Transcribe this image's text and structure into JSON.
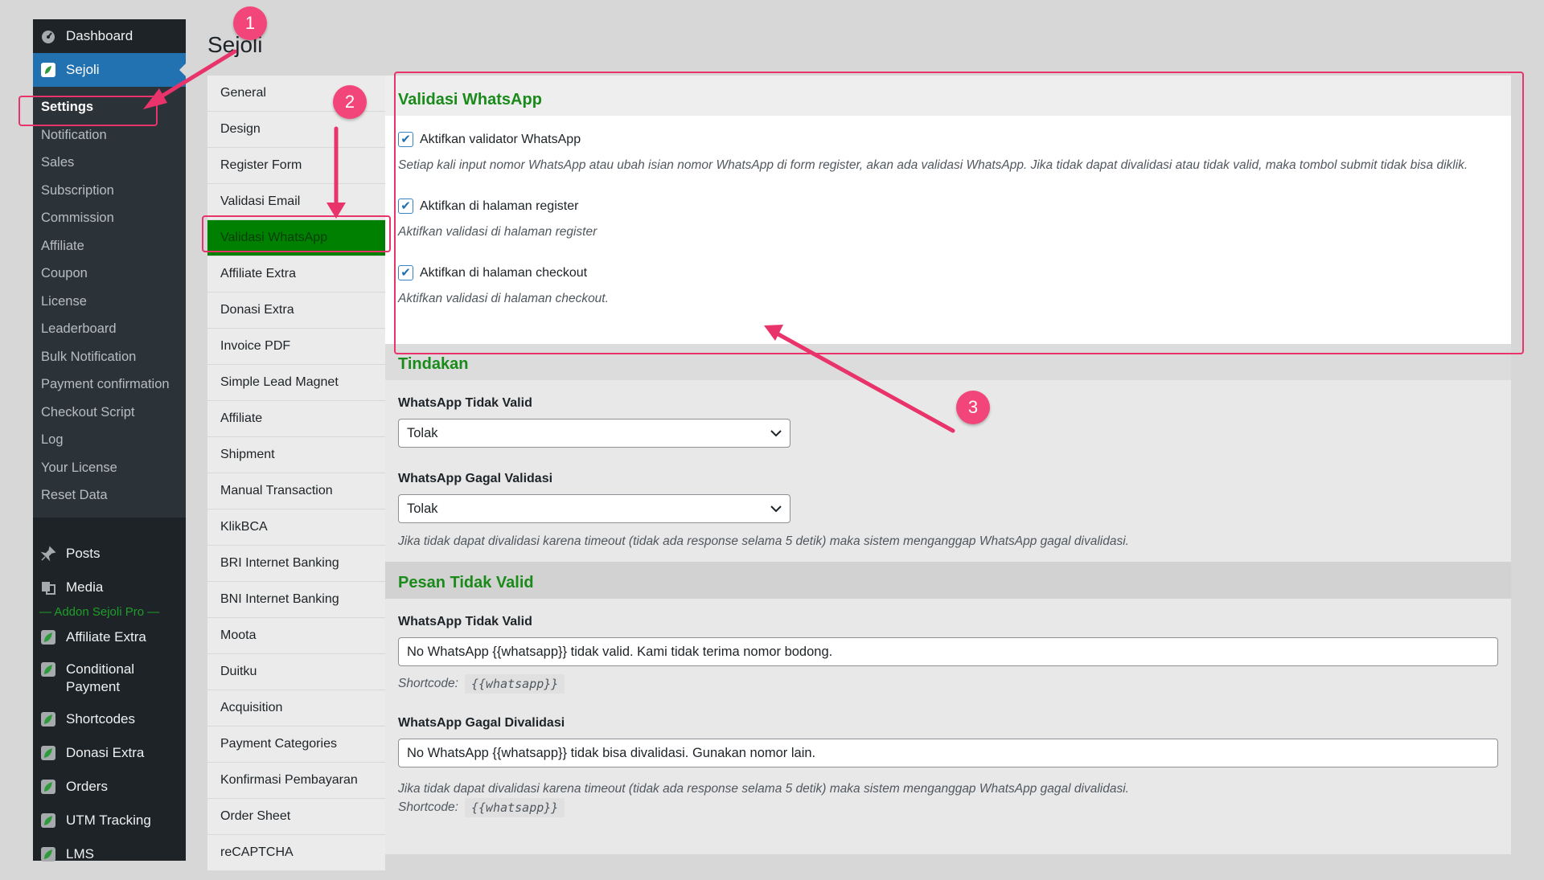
{
  "page": {
    "title": "Sejoli"
  },
  "sidebar": {
    "top_items": [
      {
        "label": "Dashboard",
        "icon": "dashboard-icon"
      },
      {
        "label": "Sejoli",
        "icon": "sejoli-icon"
      }
    ],
    "sejoli_submenu": [
      "Settings",
      "Notification",
      "Sales",
      "Subscription",
      "Commission",
      "Affiliate",
      "Coupon",
      "License",
      "Leaderboard",
      "Bulk Notification",
      "Payment confirmation",
      "Checkout Script",
      "Log",
      "Your License",
      "Reset Data"
    ],
    "items_after": [
      {
        "label": "Posts",
        "icon": "pin-icon"
      },
      {
        "label": "Media",
        "icon": "media-icon"
      }
    ],
    "addon_separator": "— Addon Sejoli Pro —",
    "addon_items": [
      "Affiliate Extra",
      "Conditional Payment",
      "Shortcodes",
      "Donasi Extra",
      "Orders",
      "UTM Tracking",
      "LMS"
    ]
  },
  "tabs": [
    "General",
    "Design",
    "Register Form",
    "Validasi Email",
    "Validasi WhatsApp",
    "Affiliate Extra",
    "Donasi Extra",
    "Invoice PDF",
    "Simple Lead Magnet",
    "Affiliate",
    "Shipment",
    "Manual Transaction",
    "KlikBCA",
    "BRI Internet Banking",
    "BNI Internet Banking",
    "Moota",
    "Duitku",
    "Acquisition",
    "Payment Categories",
    "Konfirmasi Pembayaran",
    "Order Sheet",
    "reCAPTCHA"
  ],
  "active_tab": "Validasi WhatsApp",
  "validasi": {
    "title": "Validasi WhatsApp",
    "enable_label": "Aktifkan validator WhatsApp",
    "enable_checked": true,
    "enable_desc": "Setiap kali input nomor WhatsApp atau ubah isian nomor WhatsApp di form register, akan ada validasi WhatsApp. Jika tidak dapat divalidasi atau tidak valid, maka tombol submit tidak bisa diklik.",
    "register_label": "Aktifkan di halaman register",
    "register_checked": true,
    "register_desc": "Aktifkan validasi di halaman register",
    "checkout_label": "Aktifkan di halaman checkout",
    "checkout_checked": true,
    "checkout_desc": "Aktifkan validasi di halaman checkout."
  },
  "tindakan": {
    "title": "Tindakan",
    "invalid_label": "WhatsApp Tidak Valid",
    "invalid_value": "Tolak",
    "failed_label": "WhatsApp Gagal Validasi",
    "failed_value": "Tolak",
    "note": "Jika tidak dapat divalidasi karena timeout (tidak ada response selama 5 detik) maka sistem menganggap WhatsApp gagal divalidasi."
  },
  "pesan": {
    "title": "Pesan Tidak Valid",
    "invalid_label": "WhatsApp Tidak Valid",
    "invalid_value": "No WhatsApp {{whatsapp}} tidak valid. Kami tidak terima nomor bodong.",
    "shortcode_label": "Shortcode:",
    "shortcode": "{{whatsapp}}",
    "failed_label": "WhatsApp Gagal Divalidasi",
    "failed_value": "No WhatsApp {{whatsapp}} tidak bisa divalidasi. Gunakan nomor lain.",
    "failed_note": "Jika tidak dapat divalidasi karena timeout (tidak ada response selama 5 detik) maka sistem menganggap WhatsApp gagal divalidasi.",
    "failed_shortcode_label": "Shortcode:",
    "failed_shortcode": "{{whatsapp}}"
  },
  "annotations": {
    "badge1": "1",
    "badge2": "2",
    "badge3": "3",
    "color": "#e8336b"
  },
  "colors": {
    "sidebar_bg": "#1d2327",
    "current_menu": "#2271b1",
    "active_tab": "#008000",
    "section_title": "#1a8a1a"
  }
}
